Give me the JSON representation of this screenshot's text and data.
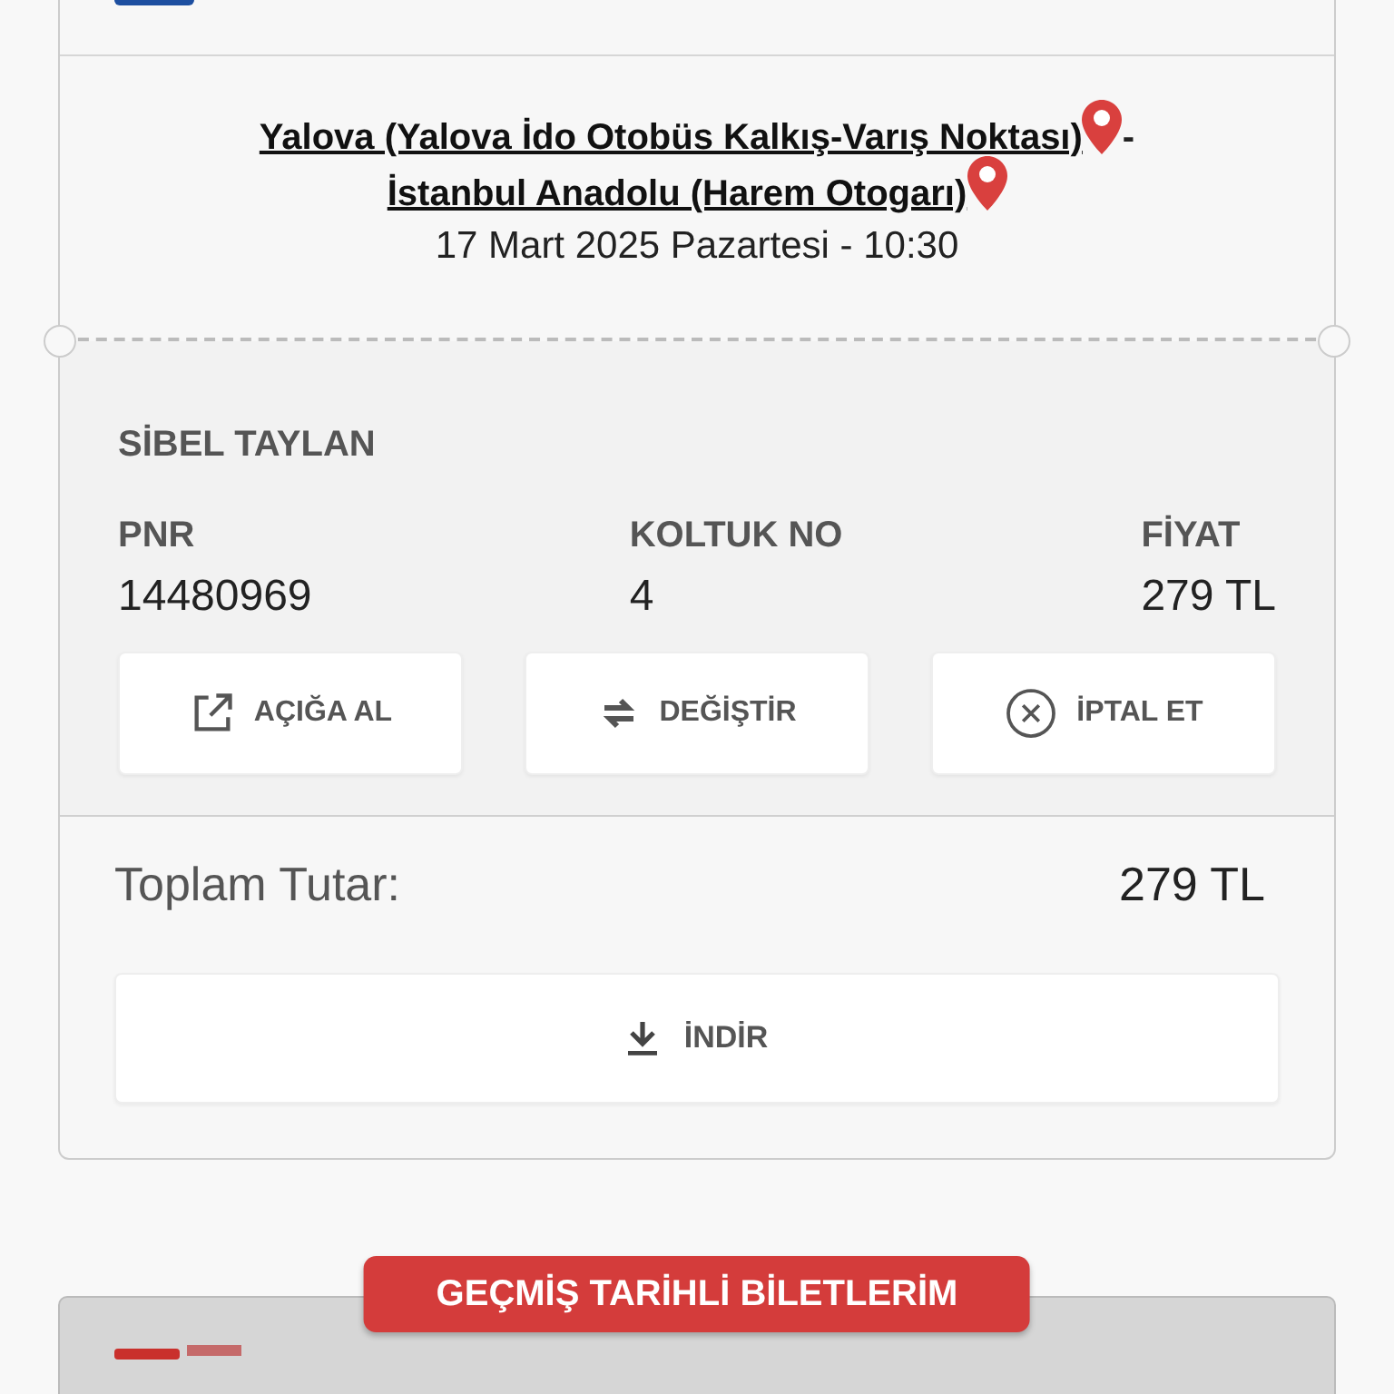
{
  "ticket": {
    "route_stops": [
      {
        "name": "Yalova (Yalova İdo Otobüs Kalkış-Varış Noktası)"
      },
      {
        "name": "İstanbul Anadolu (Harem Otogarı)"
      }
    ],
    "route_separator": "-",
    "date": "17 Mart 2025 Pazartesi - 10:30",
    "passenger": "SİBEL TAYLAN",
    "fields": [
      {
        "label": "PNR",
        "value": "14480969"
      },
      {
        "label": "KOLTUK NO",
        "value": "4"
      },
      {
        "label": "FİYAT",
        "value": "279 TL"
      }
    ],
    "actions": [
      {
        "kind": "release",
        "label": "AÇIĞA AL"
      },
      {
        "kind": "change",
        "label": "DEĞİŞTİR"
      },
      {
        "kind": "cancel",
        "label": "İPTAL ET"
      }
    ],
    "total_label": "Toplam Tutar:",
    "total_value": "279 TL",
    "download_label": "İNDİR"
  },
  "history_button": "GEÇMİŞ TARİHLİ BİLETLERİM"
}
